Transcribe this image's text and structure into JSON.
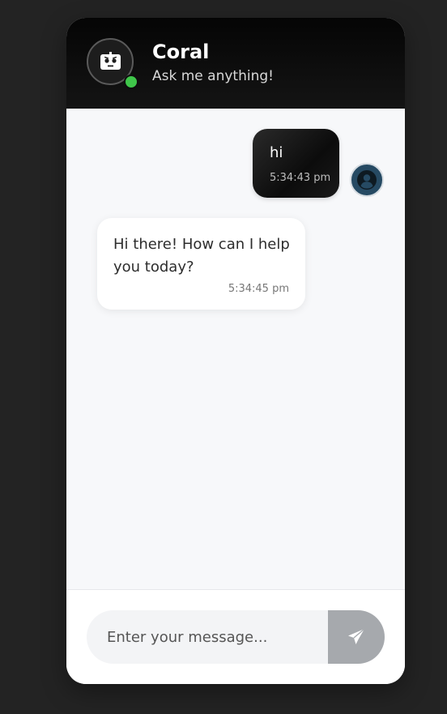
{
  "header": {
    "title": "Coral",
    "subtitle": "Ask me anything!",
    "status": "online",
    "status_color": "#3fc64a",
    "bot_icon": "robot-icon"
  },
  "messages": [
    {
      "sender": "user",
      "text": "hi",
      "time": "5:34:43 pm",
      "avatar_icon": "user-circle-icon"
    },
    {
      "sender": "bot",
      "text": "Hi there! How can I help you today?",
      "time": "5:34:45 pm"
    }
  ],
  "composer": {
    "placeholder": "Enter your message...",
    "value": "",
    "send_icon": "paper-plane-icon"
  },
  "colors": {
    "header_bg": "#0a0a0a",
    "user_bubble": "#111111",
    "bot_bubble": "#ffffff",
    "send_button": "#a6a9ad",
    "user_avatar": "#264a63"
  }
}
